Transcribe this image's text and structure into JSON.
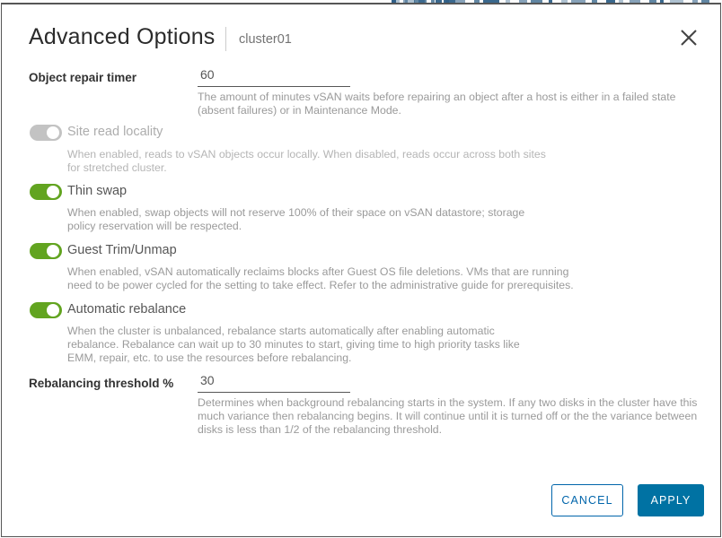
{
  "window": {
    "title": "Advanced Options",
    "subtitle": "cluster01",
    "close_icon": "close-icon"
  },
  "colors": {
    "toggle_on": "#62a420",
    "toggle_off": "#c3c3c3",
    "primary_button": "#0072a3",
    "link_blue": "#0065ab",
    "label_text": "#333333",
    "helper_text": "#9a9a9a",
    "disabled_text": "#adadad"
  },
  "fields": {
    "object_repair_timer": {
      "label": "Object repair timer",
      "value": "60",
      "placeholder": "",
      "helper": "The amount of minutes vSAN waits before repairing an object after a host is either in a failed state (absent failures) or in Maintenance Mode."
    },
    "rebalancing_threshold": {
      "label": "Rebalancing threshold %",
      "value": "30",
      "placeholder": "",
      "helper": "Determines when background rebalancing starts in the system. If any two disks in the cluster have this much variance then rebalancing begins. It will continue until it is turned off or the the variance between disks is less than 1/2 of the rebalancing threshold."
    }
  },
  "toggles": [
    {
      "key": "site_read_locality",
      "label": "Site read locality",
      "state": "off",
      "disabled": true,
      "helper": "When enabled, reads to vSAN objects occur locally. When disabled, reads occur across both sites for stretched cluster."
    },
    {
      "key": "thin_swap",
      "label": "Thin swap",
      "state": "on",
      "disabled": false,
      "helper": "When enabled, swap objects will not reserve 100% of their space on vSAN datastore; storage policy reservation will be respected."
    },
    {
      "key": "guest_trim_unmap",
      "label": "Guest Trim/Unmap",
      "state": "on",
      "disabled": false,
      "helper": "When enabled, vSAN automatically reclaims blocks after Guest OS file deletions. VMs that are running need to be power cycled for the setting to take effect. Refer to the administrative guide for prerequisites."
    },
    {
      "key": "automatic_rebalance",
      "label": "Automatic rebalance",
      "state": "on",
      "disabled": false,
      "helper": "When the cluster is unbalanced, rebalance starts automatically after enabling automatic rebalance. Rebalance can wait up to 30 minutes to start, giving time to high priority tasks like EMM, repair, etc. to use the resources before rebalancing."
    }
  ],
  "footer": {
    "cancel_label": "CANCEL",
    "apply_label": "APPLY"
  }
}
